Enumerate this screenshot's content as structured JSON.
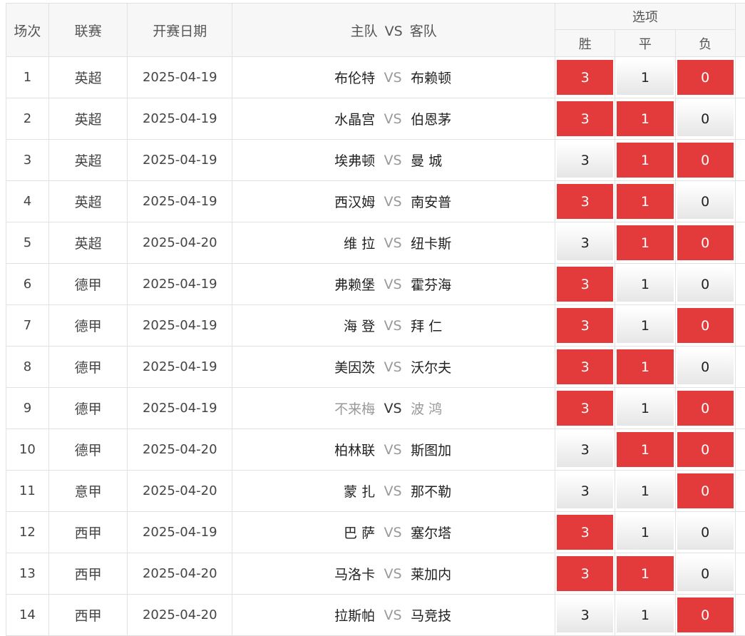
{
  "headers": {
    "index": "场次",
    "league": "联赛",
    "date": "开赛日期",
    "home": "主队",
    "vs": "VS",
    "away": "客队",
    "options": "选项",
    "win": "胜",
    "draw": "平",
    "lose": "负"
  },
  "vs_label": "VS",
  "colors": {
    "selected": "#e33b3b",
    "unselected_top": "#ffffff",
    "unselected_bottom": "#e6e6e6",
    "grid": "#e2e2e2"
  },
  "matches": [
    {
      "no": "1",
      "league": "英超",
      "date": "2025-04-19",
      "home": "布伦特",
      "away": "布赖顿",
      "win": "3",
      "draw": "1",
      "lose": "0",
      "sel": [
        true,
        false,
        true
      ],
      "muted": false
    },
    {
      "no": "2",
      "league": "英超",
      "date": "2025-04-19",
      "home": "水晶宫",
      "away": "伯恩茅",
      "win": "3",
      "draw": "1",
      "lose": "0",
      "sel": [
        true,
        true,
        false
      ],
      "muted": false
    },
    {
      "no": "3",
      "league": "英超",
      "date": "2025-04-19",
      "home": "埃弗顿",
      "away": "曼 城",
      "win": "3",
      "draw": "1",
      "lose": "0",
      "sel": [
        false,
        true,
        true
      ],
      "muted": false
    },
    {
      "no": "4",
      "league": "英超",
      "date": "2025-04-19",
      "home": "西汉姆",
      "away": "南安普",
      "win": "3",
      "draw": "1",
      "lose": "0",
      "sel": [
        true,
        true,
        false
      ],
      "muted": false
    },
    {
      "no": "5",
      "league": "英超",
      "date": "2025-04-20",
      "home": "维 拉",
      "away": "纽卡斯",
      "win": "3",
      "draw": "1",
      "lose": "0",
      "sel": [
        false,
        true,
        true
      ],
      "muted": false
    },
    {
      "no": "6",
      "league": "德甲",
      "date": "2025-04-19",
      "home": "弗赖堡",
      "away": "霍芬海",
      "win": "3",
      "draw": "1",
      "lose": "0",
      "sel": [
        true,
        false,
        false
      ],
      "muted": false
    },
    {
      "no": "7",
      "league": "德甲",
      "date": "2025-04-19",
      "home": "海 登",
      "away": "拜 仁",
      "win": "3",
      "draw": "1",
      "lose": "0",
      "sel": [
        true,
        false,
        true
      ],
      "muted": false
    },
    {
      "no": "8",
      "league": "德甲",
      "date": "2025-04-19",
      "home": "美因茨",
      "away": "沃尔夫",
      "win": "3",
      "draw": "1",
      "lose": "0",
      "sel": [
        true,
        true,
        false
      ],
      "muted": false
    },
    {
      "no": "9",
      "league": "德甲",
      "date": "2025-04-19",
      "home": "不来梅",
      "away": "波 鸿",
      "win": "3",
      "draw": "1",
      "lose": "0",
      "sel": [
        true,
        false,
        true
      ],
      "muted": true
    },
    {
      "no": "10",
      "league": "德甲",
      "date": "2025-04-20",
      "home": "柏林联",
      "away": "斯图加",
      "win": "3",
      "draw": "1",
      "lose": "0",
      "sel": [
        false,
        true,
        true
      ],
      "muted": false
    },
    {
      "no": "11",
      "league": "意甲",
      "date": "2025-04-20",
      "home": "蒙 扎",
      "away": "那不勒",
      "win": "3",
      "draw": "1",
      "lose": "0",
      "sel": [
        false,
        false,
        true
      ],
      "muted": false
    },
    {
      "no": "12",
      "league": "西甲",
      "date": "2025-04-19",
      "home": "巴 萨",
      "away": "塞尔塔",
      "win": "3",
      "draw": "1",
      "lose": "0",
      "sel": [
        true,
        false,
        false
      ],
      "muted": false
    },
    {
      "no": "13",
      "league": "西甲",
      "date": "2025-04-20",
      "home": "马洛卡",
      "away": "莱加内",
      "win": "3",
      "draw": "1",
      "lose": "0",
      "sel": [
        true,
        true,
        false
      ],
      "muted": false
    },
    {
      "no": "14",
      "league": "西甲",
      "date": "2025-04-20",
      "home": "拉斯帕",
      "away": "马竞技",
      "win": "3",
      "draw": "1",
      "lose": "0",
      "sel": [
        false,
        false,
        true
      ],
      "muted": false
    }
  ]
}
